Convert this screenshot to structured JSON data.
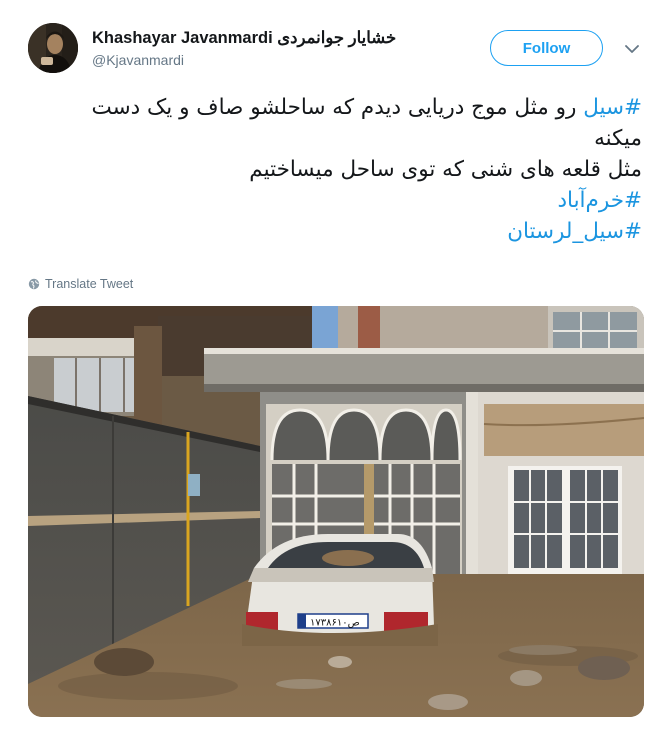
{
  "author": {
    "name": "Khashayar Javanmardi خشایار جوانمردی",
    "handle": "@Kjavanmardi"
  },
  "actions": {
    "follow_label": "Follow"
  },
  "tweet": {
    "lines": [
      [
        {
          "text": "#سیل",
          "hashtag": true
        },
        {
          "text": " رو مثل موج دریایی دیدم که ساحلشو صاف و یک دست",
          "hashtag": false
        }
      ],
      [
        {
          "text": "میکنه",
          "hashtag": false
        }
      ],
      [
        {
          "text": "مثل قلعه های شنی که توی ساحل میساختیم",
          "hashtag": false
        }
      ],
      [
        {
          "text": "#خرم‌آباد",
          "hashtag": true
        }
      ],
      [
        {
          "text": "#سیل_لرستان",
          "hashtag": true
        }
      ]
    ],
    "translate_label": "Translate Tweet",
    "media": {
      "license_plate": "۱۷ص۳۸۶۱۰"
    }
  },
  "colors": {
    "link": "#1b95e0",
    "follow": "#1da1f2",
    "secondary_text": "#657786"
  },
  "icons": [
    "globe-icon",
    "chevron-down-icon"
  ]
}
